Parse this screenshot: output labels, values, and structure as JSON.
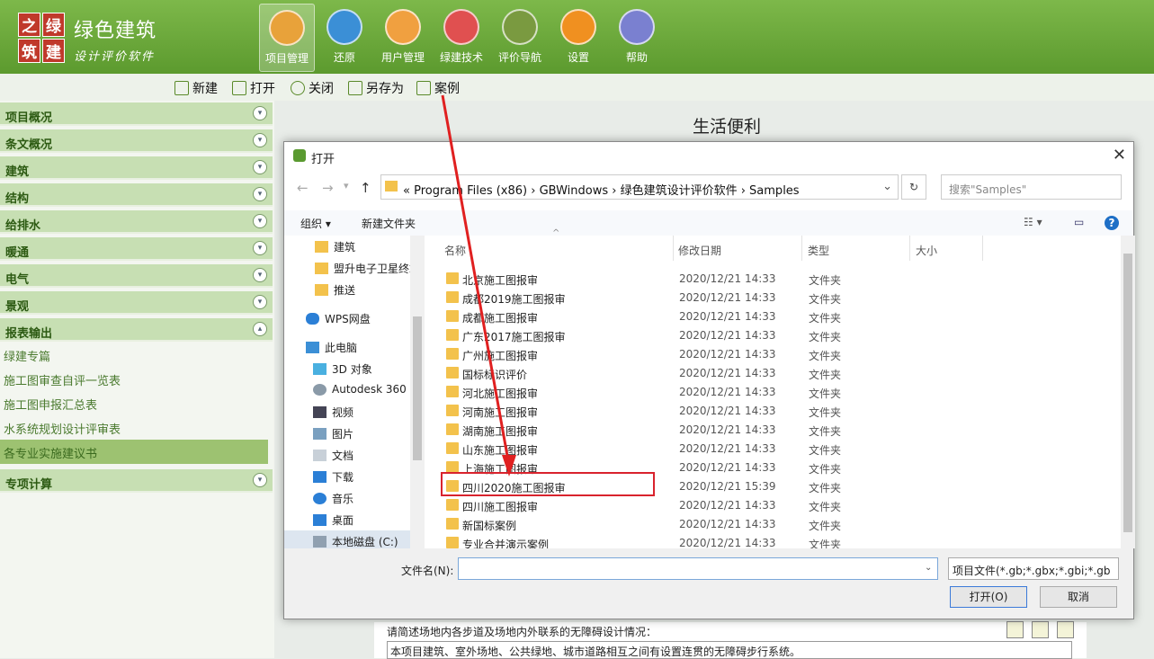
{
  "app": {
    "logo_chars": [
      "之",
      "绿",
      "筑",
      "建"
    ],
    "title": "绿色建筑",
    "subtitle": "设计评价软件"
  },
  "toolbar": [
    {
      "label": "项目管理",
      "icon": "folder-icon",
      "color": "#e8a23a",
      "active": true
    },
    {
      "label": "还原",
      "icon": "refresh-icon",
      "color": "#3b8fd6",
      "active": false
    },
    {
      "label": "用户管理",
      "icon": "users-icon",
      "color": "#f0a040",
      "active": false
    },
    {
      "label": "绿建技术",
      "icon": "network-icon",
      "color": "#e05050",
      "active": false
    },
    {
      "label": "评价导航",
      "icon": "document-icon",
      "color": "#7a9a40",
      "active": false
    },
    {
      "label": "设置",
      "icon": "gear-icon",
      "color": "#f09020",
      "active": false
    },
    {
      "label": "帮助",
      "icon": "help-icon",
      "color": "#7a80d0",
      "active": false
    }
  ],
  "subtoolbar": [
    "新建",
    "打开",
    "关闭",
    "另存为",
    "案例"
  ],
  "sidebar": {
    "sections": [
      "项目概况",
      "条文概况",
      "建筑",
      "结构",
      "给排水",
      "暖通",
      "电气",
      "景观",
      "报表输出"
    ],
    "items": [
      "绿建专篇",
      "施工图审查自评一览表",
      "施工图申报汇总表",
      "水系统规划设计评审表",
      "各专业实施建议书"
    ],
    "last_section": "专项计算"
  },
  "main": {
    "title": "生活便利",
    "question": "请简述场地内各步道及场地内外联系的无障碍设计情况：",
    "answer": "本项目建筑、室外场地、公共绿地、城市道路相互之间有设置连贯的无障碍步行系统。"
  },
  "dialog": {
    "title": "打开",
    "address": "«  Program Files (x86)  ›  GBWindows  ›  绿色建筑设计评价软件  ›  Samples",
    "search_placeholder": "搜索\"Samples\"",
    "organize": "组织 ▾",
    "new_folder": "新建文件夹",
    "tree": [
      {
        "label": "建筑",
        "icon": "folder-icon"
      },
      {
        "label": "盟升电子卫星终端",
        "icon": "folder-icon"
      },
      {
        "label": "推送",
        "icon": "folder-icon"
      },
      {
        "label": "WPS网盘",
        "icon": "cloud-icon"
      },
      {
        "label": "此电脑",
        "icon": "computer-icon"
      },
      {
        "label": "3D 对象",
        "icon": "cube-icon"
      },
      {
        "label": "Autodesk 360",
        "icon": "autodesk-icon"
      },
      {
        "label": "视频",
        "icon": "video-icon"
      },
      {
        "label": "图片",
        "icon": "image-icon"
      },
      {
        "label": "文档",
        "icon": "document-icon"
      },
      {
        "label": "下载",
        "icon": "download-icon"
      },
      {
        "label": "音乐",
        "icon": "music-icon"
      },
      {
        "label": "桌面",
        "icon": "desktop-icon"
      },
      {
        "label": "本地磁盘 (C:)",
        "icon": "disk-icon"
      }
    ],
    "columns": [
      "名称",
      "修改日期",
      "类型",
      "大小"
    ],
    "files": [
      {
        "name": "北京施工图报审",
        "date": "2020/12/21 14:33",
        "type": "文件夹"
      },
      {
        "name": "成都2019施工图报审",
        "date": "2020/12/21 14:33",
        "type": "文件夹"
      },
      {
        "name": "成都施工图报审",
        "date": "2020/12/21 14:33",
        "type": "文件夹"
      },
      {
        "name": "广东2017施工图报审",
        "date": "2020/12/21 14:33",
        "type": "文件夹"
      },
      {
        "name": "广州施工图报审",
        "date": "2020/12/21 14:33",
        "type": "文件夹"
      },
      {
        "name": "国标标识评价",
        "date": "2020/12/21 14:33",
        "type": "文件夹"
      },
      {
        "name": "河北施工图报审",
        "date": "2020/12/21 14:33",
        "type": "文件夹"
      },
      {
        "name": "河南施工图报审",
        "date": "2020/12/21 14:33",
        "type": "文件夹"
      },
      {
        "name": "湖南施工图报审",
        "date": "2020/12/21 14:33",
        "type": "文件夹"
      },
      {
        "name": "山东施工图报审",
        "date": "2020/12/21 14:33",
        "type": "文件夹"
      },
      {
        "name": "上海施工图报审",
        "date": "2020/12/21 14:33",
        "type": "文件夹"
      },
      {
        "name": "四川2020施工图报审",
        "date": "2020/12/21 15:39",
        "type": "文件夹"
      },
      {
        "name": "四川施工图报审",
        "date": "2020/12/21 14:33",
        "type": "文件夹"
      },
      {
        "name": "新国标案例",
        "date": "2020/12/21 14:33",
        "type": "文件夹"
      },
      {
        "name": "专业合并演示案例",
        "date": "2020/12/21 14:33",
        "type": "文件夹"
      }
    ],
    "filename_label": "文件名(N):",
    "filename_value": "",
    "filetype": "项目文件(*.gb;*.gbx;*.gbi;*.gb",
    "open_button": "打开(O)",
    "cancel_button": "取消"
  }
}
